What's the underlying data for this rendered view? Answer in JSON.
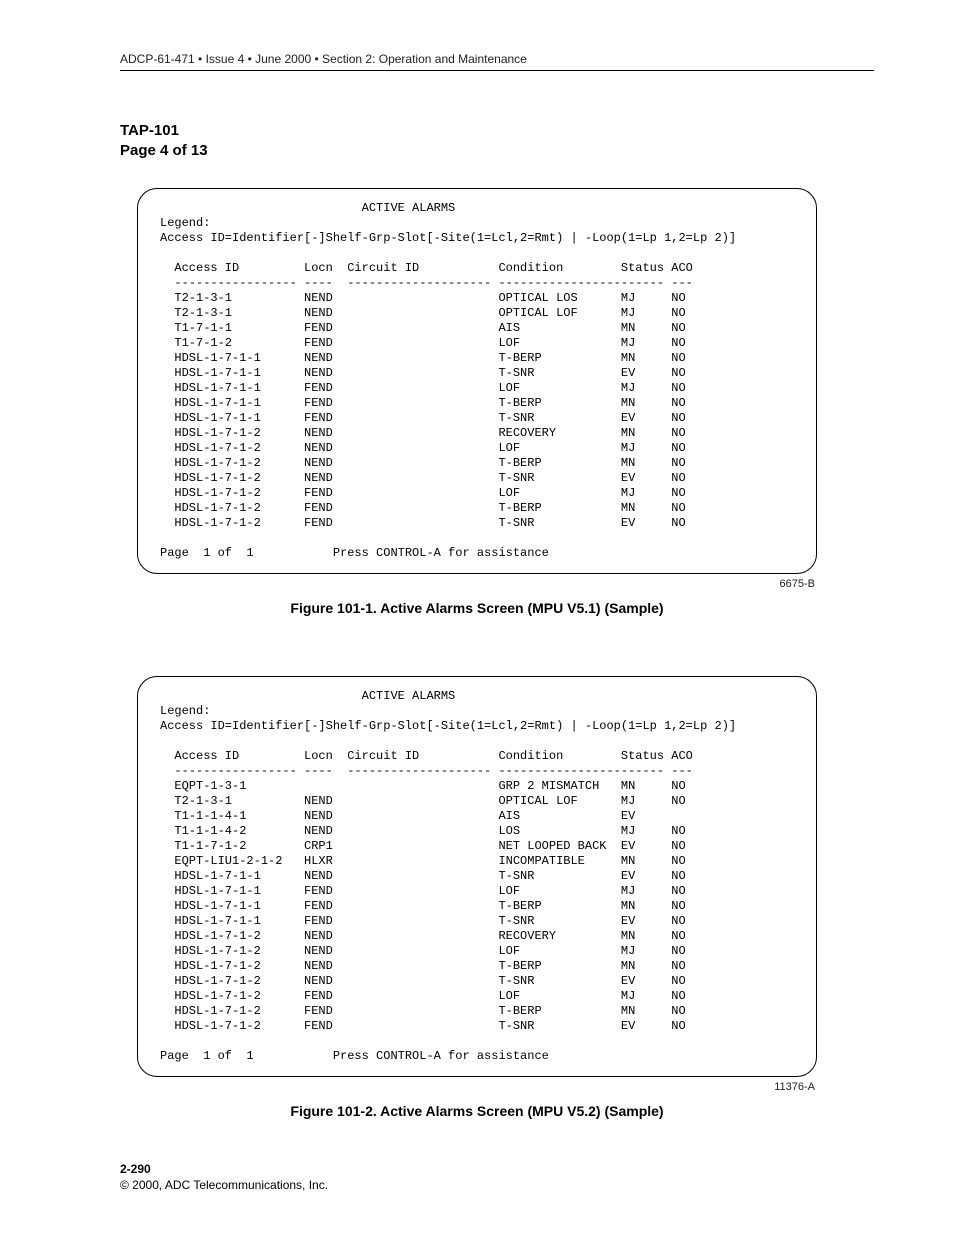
{
  "header": {
    "running_head": "ADCP-61-471 • Issue 4 • June 2000 • Section 2: Operation and Maintenance",
    "tap": "TAP-101",
    "page_of": "Page 4 of 13"
  },
  "panels": [
    {
      "title": "ACTIVE ALARMS",
      "legend_label": "Legend:",
      "legend_line": "Access ID=Identifier[-]Shelf-Grp-Slot[-Site(1=Lcl,2=Rmt) | -Loop(1=Lp 1,2=Lp 2)]",
      "columns": {
        "c1": "Access ID",
        "c2": "Locn",
        "c3": "Circuit ID",
        "c4": "Condition",
        "c5": "Status",
        "c6": "ACO"
      },
      "rows": [
        {
          "c1": "T2-1-3-1",
          "c2": "NEND",
          "c4": "OPTICAL LOS",
          "c5": "MJ",
          "c6": "NO"
        },
        {
          "c1": "T2-1-3-1",
          "c2": "NEND",
          "c4": "OPTICAL LOF",
          "c5": "MJ",
          "c6": "NO"
        },
        {
          "c1": "T1-7-1-1",
          "c2": "FEND",
          "c4": "AIS",
          "c5": "MN",
          "c6": "NO"
        },
        {
          "c1": "T1-7-1-2",
          "c2": "FEND",
          "c4": "LOF",
          "c5": "MJ",
          "c6": "NO"
        },
        {
          "c1": "HDSL-1-7-1-1",
          "c2": "NEND",
          "c4": "T-BERP",
          "c5": "MN",
          "c6": "NO"
        },
        {
          "c1": "HDSL-1-7-1-1",
          "c2": "NEND",
          "c4": "T-SNR",
          "c5": "EV",
          "c6": "NO"
        },
        {
          "c1": "HDSL-1-7-1-1",
          "c2": "FEND",
          "c4": "LOF",
          "c5": "MJ",
          "c6": "NO"
        },
        {
          "c1": "HDSL-1-7-1-1",
          "c2": "FEND",
          "c4": "T-BERP",
          "c5": "MN",
          "c6": "NO"
        },
        {
          "c1": "HDSL-1-7-1-1",
          "c2": "FEND",
          "c4": "T-SNR",
          "c5": "EV",
          "c6": "NO"
        },
        {
          "c1": "HDSL-1-7-1-2",
          "c2": "NEND",
          "c4": "RECOVERY",
          "c5": "MN",
          "c6": "NO"
        },
        {
          "c1": "HDSL-1-7-1-2",
          "c2": "NEND",
          "c4": "LOF",
          "c5": "MJ",
          "c6": "NO"
        },
        {
          "c1": "HDSL-1-7-1-2",
          "c2": "NEND",
          "c4": "T-BERP",
          "c5": "MN",
          "c6": "NO"
        },
        {
          "c1": "HDSL-1-7-1-2",
          "c2": "NEND",
          "c4": "T-SNR",
          "c5": "EV",
          "c6": "NO"
        },
        {
          "c1": "HDSL-1-7-1-2",
          "c2": "FEND",
          "c4": "LOF",
          "c5": "MJ",
          "c6": "NO"
        },
        {
          "c1": "HDSL-1-7-1-2",
          "c2": "FEND",
          "c4": "T-BERP",
          "c5": "MN",
          "c6": "NO"
        },
        {
          "c1": "HDSL-1-7-1-2",
          "c2": "FEND",
          "c4": "T-SNR",
          "c5": "EV",
          "c6": "NO"
        }
      ],
      "footer": "Page  1 of  1           Press CONTROL-A for assistance",
      "panel_id": "6675-B",
      "caption": "Figure 101-1. Active Alarms Screen (MPU V5.1) (Sample)"
    },
    {
      "title": "ACTIVE ALARMS",
      "legend_label": "Legend:",
      "legend_line": "Access ID=Identifier[-]Shelf-Grp-Slot[-Site(1=Lcl,2=Rmt) | -Loop(1=Lp 1,2=Lp 2)]",
      "columns": {
        "c1": "Access ID",
        "c2": "Locn",
        "c3": "Circuit ID",
        "c4": "Condition",
        "c5": "Status",
        "c6": "ACO"
      },
      "rows": [
        {
          "c1": "EQPT-1-3-1",
          "c2": "",
          "c4": "GRP 2 MISMATCH",
          "c5": "MN",
          "c6": "NO"
        },
        {
          "c1": "T2-1-3-1",
          "c2": "NEND",
          "c4": "OPTICAL LOF",
          "c5": "MJ",
          "c6": "NO"
        },
        {
          "c1": "T1-1-1-4-1",
          "c2": "NEND",
          "c4": "AIS",
          "c5": "EV",
          "c6": ""
        },
        {
          "c1": "T1-1-1-4-2",
          "c2": "NEND",
          "c4": "LOS",
          "c5": "MJ",
          "c6": "NO"
        },
        {
          "c1": "T1-1-7-1-2",
          "c2": "CRP1",
          "c4": "NET LOOPED BACK",
          "c5": "EV",
          "c6": "NO"
        },
        {
          "c1": "EQPT-LIU1-2-1-2",
          "c2": "HLXR",
          "c4": "INCOMPATIBLE",
          "c5": "MN",
          "c6": "NO"
        },
        {
          "c1": "HDSL-1-7-1-1",
          "c2": "NEND",
          "c4": "T-SNR",
          "c5": "EV",
          "c6": "NO"
        },
        {
          "c1": "HDSL-1-7-1-1",
          "c2": "FEND",
          "c4": "LOF",
          "c5": "MJ",
          "c6": "NO"
        },
        {
          "c1": "HDSL-1-7-1-1",
          "c2": "FEND",
          "c4": "T-BERP",
          "c5": "MN",
          "c6": "NO"
        },
        {
          "c1": "HDSL-1-7-1-1",
          "c2": "FEND",
          "c4": "T-SNR",
          "c5": "EV",
          "c6": "NO"
        },
        {
          "c1": "HDSL-1-7-1-2",
          "c2": "NEND",
          "c4": "RECOVERY",
          "c5": "MN",
          "c6": "NO"
        },
        {
          "c1": "HDSL-1-7-1-2",
          "c2": "NEND",
          "c4": "LOF",
          "c5": "MJ",
          "c6": "NO"
        },
        {
          "c1": "HDSL-1-7-1-2",
          "c2": "NEND",
          "c4": "T-BERP",
          "c5": "MN",
          "c6": "NO"
        },
        {
          "c1": "HDSL-1-7-1-2",
          "c2": "NEND",
          "c4": "T-SNR",
          "c5": "EV",
          "c6": "NO"
        },
        {
          "c1": "HDSL-1-7-1-2",
          "c2": "FEND",
          "c4": "LOF",
          "c5": "MJ",
          "c6": "NO"
        },
        {
          "c1": "HDSL-1-7-1-2",
          "c2": "FEND",
          "c4": "T-BERP",
          "c5": "MN",
          "c6": "NO"
        },
        {
          "c1": "HDSL-1-7-1-2",
          "c2": "FEND",
          "c4": "T-SNR",
          "c5": "EV",
          "c6": "NO"
        }
      ],
      "footer": "Page  1 of  1           Press CONTROL-A for assistance",
      "panel_id": "11376-A",
      "caption": "Figure 101-2. Active Alarms Screen (MPU V5.2) (Sample)"
    }
  ],
  "footer": {
    "page_num": "2-290",
    "copyright": "© 2000, ADC Telecommunications, Inc."
  }
}
